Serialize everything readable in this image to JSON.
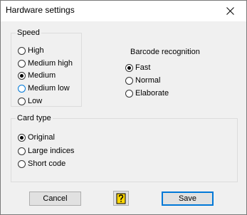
{
  "window": {
    "title": "Hardware settings"
  },
  "speed": {
    "legend": "Speed",
    "options": [
      {
        "label": "High",
        "selected": false
      },
      {
        "label": "Medium high",
        "selected": false
      },
      {
        "label": "Medium",
        "selected": true
      },
      {
        "label": "Medium low",
        "selected": false
      },
      {
        "label": "Low",
        "selected": false
      }
    ]
  },
  "barcode": {
    "label": "Barcode recognition",
    "options": [
      {
        "label": "Fast",
        "selected": true
      },
      {
        "label": "Normal",
        "selected": false
      },
      {
        "label": "Elaborate",
        "selected": false
      }
    ]
  },
  "card_type": {
    "legend": "Card type",
    "options": [
      {
        "label": "Original",
        "selected": true
      },
      {
        "label": "Large indices",
        "selected": false
      },
      {
        "label": "Short code",
        "selected": false
      }
    ]
  },
  "buttons": {
    "cancel": "Cancel",
    "help_icon": "help-question-icon",
    "save": "Save"
  },
  "colors": {
    "focus_accent": "#0078d7",
    "dialog_bg": "#f0f0f0",
    "help_icon_yellow": "#ffd700"
  }
}
